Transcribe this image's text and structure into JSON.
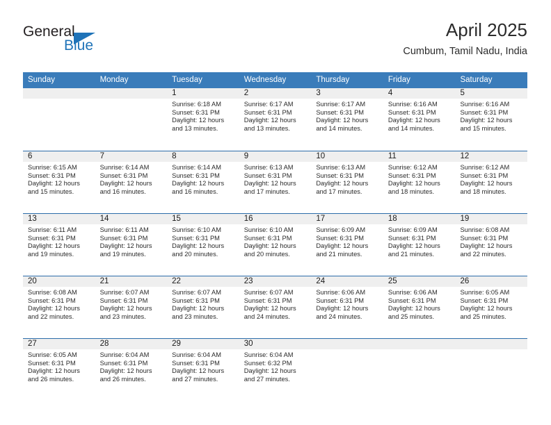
{
  "brand": {
    "name_part1": "General",
    "name_part2": "Blue",
    "logo_icon": "triangle-flag-icon",
    "accent_color": "#1f73b8"
  },
  "header": {
    "title": "April 2025",
    "location": "Cumbum, Tamil Nadu, India",
    "header_bg_color": "#3a7cba",
    "row_divider_color": "#2b6ca9",
    "daynum_band_color": "#efefef"
  },
  "weekdays": [
    "Sunday",
    "Monday",
    "Tuesday",
    "Wednesday",
    "Thursday",
    "Friday",
    "Saturday"
  ],
  "weeks": [
    [
      {
        "day": "",
        "empty": true,
        "sunrise": "",
        "sunset": "",
        "daylight1": "",
        "daylight2": ""
      },
      {
        "day": "",
        "empty": true,
        "sunrise": "",
        "sunset": "",
        "daylight1": "",
        "daylight2": ""
      },
      {
        "day": "1",
        "empty": false,
        "sunrise": "Sunrise: 6:18 AM",
        "sunset": "Sunset: 6:31 PM",
        "daylight1": "Daylight: 12 hours",
        "daylight2": "and 13 minutes."
      },
      {
        "day": "2",
        "empty": false,
        "sunrise": "Sunrise: 6:17 AM",
        "sunset": "Sunset: 6:31 PM",
        "daylight1": "Daylight: 12 hours",
        "daylight2": "and 13 minutes."
      },
      {
        "day": "3",
        "empty": false,
        "sunrise": "Sunrise: 6:17 AM",
        "sunset": "Sunset: 6:31 PM",
        "daylight1": "Daylight: 12 hours",
        "daylight2": "and 14 minutes."
      },
      {
        "day": "4",
        "empty": false,
        "sunrise": "Sunrise: 6:16 AM",
        "sunset": "Sunset: 6:31 PM",
        "daylight1": "Daylight: 12 hours",
        "daylight2": "and 14 minutes."
      },
      {
        "day": "5",
        "empty": false,
        "sunrise": "Sunrise: 6:16 AM",
        "sunset": "Sunset: 6:31 PM",
        "daylight1": "Daylight: 12 hours",
        "daylight2": "and 15 minutes."
      }
    ],
    [
      {
        "day": "6",
        "empty": false,
        "sunrise": "Sunrise: 6:15 AM",
        "sunset": "Sunset: 6:31 PM",
        "daylight1": "Daylight: 12 hours",
        "daylight2": "and 15 minutes."
      },
      {
        "day": "7",
        "empty": false,
        "sunrise": "Sunrise: 6:14 AM",
        "sunset": "Sunset: 6:31 PM",
        "daylight1": "Daylight: 12 hours",
        "daylight2": "and 16 minutes."
      },
      {
        "day": "8",
        "empty": false,
        "sunrise": "Sunrise: 6:14 AM",
        "sunset": "Sunset: 6:31 PM",
        "daylight1": "Daylight: 12 hours",
        "daylight2": "and 16 minutes."
      },
      {
        "day": "9",
        "empty": false,
        "sunrise": "Sunrise: 6:13 AM",
        "sunset": "Sunset: 6:31 PM",
        "daylight1": "Daylight: 12 hours",
        "daylight2": "and 17 minutes."
      },
      {
        "day": "10",
        "empty": false,
        "sunrise": "Sunrise: 6:13 AM",
        "sunset": "Sunset: 6:31 PM",
        "daylight1": "Daylight: 12 hours",
        "daylight2": "and 17 minutes."
      },
      {
        "day": "11",
        "empty": false,
        "sunrise": "Sunrise: 6:12 AM",
        "sunset": "Sunset: 6:31 PM",
        "daylight1": "Daylight: 12 hours",
        "daylight2": "and 18 minutes."
      },
      {
        "day": "12",
        "empty": false,
        "sunrise": "Sunrise: 6:12 AM",
        "sunset": "Sunset: 6:31 PM",
        "daylight1": "Daylight: 12 hours",
        "daylight2": "and 18 minutes."
      }
    ],
    [
      {
        "day": "13",
        "empty": false,
        "sunrise": "Sunrise: 6:11 AM",
        "sunset": "Sunset: 6:31 PM",
        "daylight1": "Daylight: 12 hours",
        "daylight2": "and 19 minutes."
      },
      {
        "day": "14",
        "empty": false,
        "sunrise": "Sunrise: 6:11 AM",
        "sunset": "Sunset: 6:31 PM",
        "daylight1": "Daylight: 12 hours",
        "daylight2": "and 19 minutes."
      },
      {
        "day": "15",
        "empty": false,
        "sunrise": "Sunrise: 6:10 AM",
        "sunset": "Sunset: 6:31 PM",
        "daylight1": "Daylight: 12 hours",
        "daylight2": "and 20 minutes."
      },
      {
        "day": "16",
        "empty": false,
        "sunrise": "Sunrise: 6:10 AM",
        "sunset": "Sunset: 6:31 PM",
        "daylight1": "Daylight: 12 hours",
        "daylight2": "and 20 minutes."
      },
      {
        "day": "17",
        "empty": false,
        "sunrise": "Sunrise: 6:09 AM",
        "sunset": "Sunset: 6:31 PM",
        "daylight1": "Daylight: 12 hours",
        "daylight2": "and 21 minutes."
      },
      {
        "day": "18",
        "empty": false,
        "sunrise": "Sunrise: 6:09 AM",
        "sunset": "Sunset: 6:31 PM",
        "daylight1": "Daylight: 12 hours",
        "daylight2": "and 21 minutes."
      },
      {
        "day": "19",
        "empty": false,
        "sunrise": "Sunrise: 6:08 AM",
        "sunset": "Sunset: 6:31 PM",
        "daylight1": "Daylight: 12 hours",
        "daylight2": "and 22 minutes."
      }
    ],
    [
      {
        "day": "20",
        "empty": false,
        "sunrise": "Sunrise: 6:08 AM",
        "sunset": "Sunset: 6:31 PM",
        "daylight1": "Daylight: 12 hours",
        "daylight2": "and 22 minutes."
      },
      {
        "day": "21",
        "empty": false,
        "sunrise": "Sunrise: 6:07 AM",
        "sunset": "Sunset: 6:31 PM",
        "daylight1": "Daylight: 12 hours",
        "daylight2": "and 23 minutes."
      },
      {
        "day": "22",
        "empty": false,
        "sunrise": "Sunrise: 6:07 AM",
        "sunset": "Sunset: 6:31 PM",
        "daylight1": "Daylight: 12 hours",
        "daylight2": "and 23 minutes."
      },
      {
        "day": "23",
        "empty": false,
        "sunrise": "Sunrise: 6:07 AM",
        "sunset": "Sunset: 6:31 PM",
        "daylight1": "Daylight: 12 hours",
        "daylight2": "and 24 minutes."
      },
      {
        "day": "24",
        "empty": false,
        "sunrise": "Sunrise: 6:06 AM",
        "sunset": "Sunset: 6:31 PM",
        "daylight1": "Daylight: 12 hours",
        "daylight2": "and 24 minutes."
      },
      {
        "day": "25",
        "empty": false,
        "sunrise": "Sunrise: 6:06 AM",
        "sunset": "Sunset: 6:31 PM",
        "daylight1": "Daylight: 12 hours",
        "daylight2": "and 25 minutes."
      },
      {
        "day": "26",
        "empty": false,
        "sunrise": "Sunrise: 6:05 AM",
        "sunset": "Sunset: 6:31 PM",
        "daylight1": "Daylight: 12 hours",
        "daylight2": "and 25 minutes."
      }
    ],
    [
      {
        "day": "27",
        "empty": false,
        "sunrise": "Sunrise: 6:05 AM",
        "sunset": "Sunset: 6:31 PM",
        "daylight1": "Daylight: 12 hours",
        "daylight2": "and 26 minutes."
      },
      {
        "day": "28",
        "empty": false,
        "sunrise": "Sunrise: 6:04 AM",
        "sunset": "Sunset: 6:31 PM",
        "daylight1": "Daylight: 12 hours",
        "daylight2": "and 26 minutes."
      },
      {
        "day": "29",
        "empty": false,
        "sunrise": "Sunrise: 6:04 AM",
        "sunset": "Sunset: 6:31 PM",
        "daylight1": "Daylight: 12 hours",
        "daylight2": "and 27 minutes."
      },
      {
        "day": "30",
        "empty": false,
        "sunrise": "Sunrise: 6:04 AM",
        "sunset": "Sunset: 6:32 PM",
        "daylight1": "Daylight: 12 hours",
        "daylight2": "and 27 minutes."
      },
      {
        "day": "",
        "empty": true,
        "sunrise": "",
        "sunset": "",
        "daylight1": "",
        "daylight2": ""
      },
      {
        "day": "",
        "empty": true,
        "sunrise": "",
        "sunset": "",
        "daylight1": "",
        "daylight2": ""
      },
      {
        "day": "",
        "empty": true,
        "sunrise": "",
        "sunset": "",
        "daylight1": "",
        "daylight2": ""
      }
    ]
  ]
}
